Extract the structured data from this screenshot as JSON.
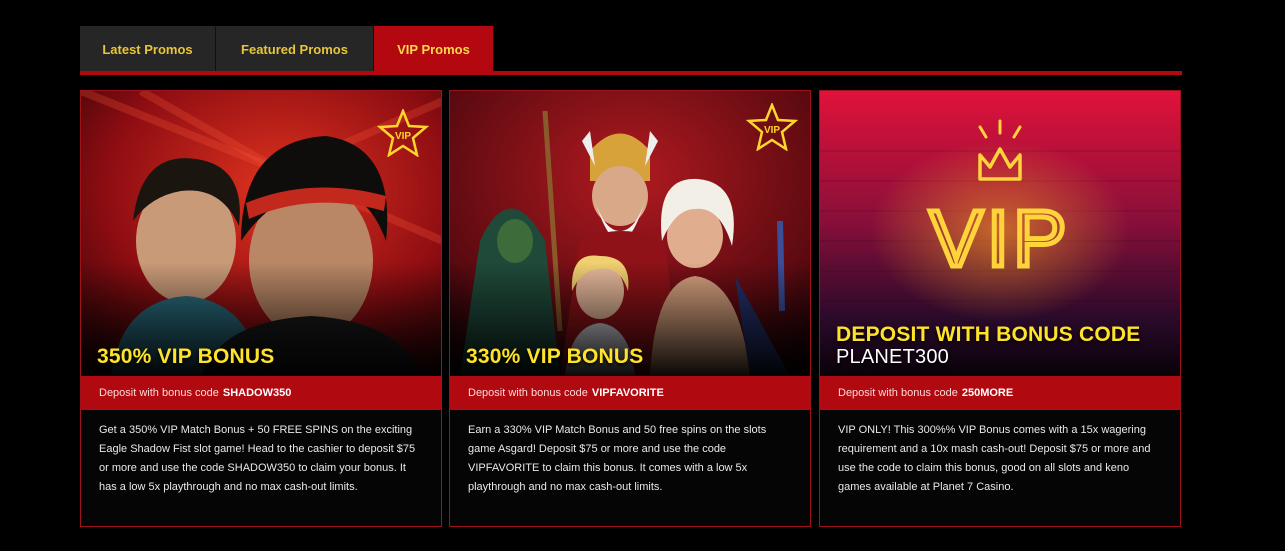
{
  "tabs": [
    {
      "label": "Latest Promos",
      "active": false
    },
    {
      "label": "Featured Promos",
      "active": false
    },
    {
      "label": "VIP Promos",
      "active": true
    }
  ],
  "colors": {
    "accent": "#b3080f",
    "headline": "#ffe22a",
    "tab_text": "#e8c53a"
  },
  "promos": [
    {
      "badge": "VIP",
      "title": "350% VIP BONUS",
      "code_label": "Deposit with bonus code",
      "code": "SHADOW350",
      "description": "Get a 350% VIP Match Bonus + 50 FREE SPINS on the exciting Eagle Shadow Fist slot game! Head to the cashier to deposit $75 or more and use the code SHADOW350 to claim your bonus. It has a low 5x playthrough and no max cash-out limits."
    },
    {
      "badge": "VIP",
      "title": "330% VIP BONUS",
      "code_label": "Deposit with bonus code",
      "code": "VIPFAVORITE",
      "description": "Earn a 330% VIP Match Bonus and 50 free spins on the slots game Asgard! Deposit $75 or more and use the code VIPFAVORITE to claim this bonus. It comes with a low 5x playthrough and no max cash-out limits."
    },
    {
      "neon_sign": "VIP",
      "title": "DEPOSIT WITH BONUS CODE",
      "title_sub": "PLANET300",
      "code_label": "Deposit with bonus code",
      "code": "250MORE",
      "description": "VIP ONLY! This 300%% VIP Bonus comes with a 15x wagering requirement and a 10x mash cash-out! Deposit $75 or more and use the code to claim this bonus, good on all slots and keno games available at Planet 7 Casino."
    }
  ]
}
